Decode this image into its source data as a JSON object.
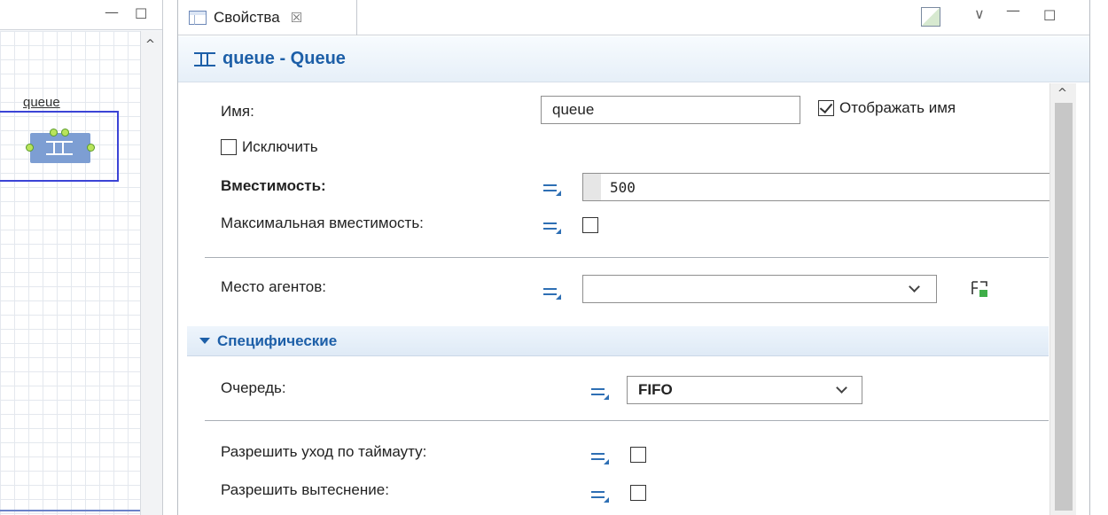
{
  "palette": {
    "accent": "#1d5fa8",
    "block": "#7d9ed3",
    "selection": "#3b44d6",
    "port": "#b9e45b"
  },
  "canvas": {
    "block_caption": "queue",
    "block_icon": "queue-block-icon",
    "scroll_up_glyph": "^"
  },
  "window_controls": {
    "minimize": "—",
    "maximize": "☐"
  },
  "tab": {
    "label": "Свойства",
    "close_glyph": "☒",
    "icon": "properties-icon"
  },
  "header": {
    "icon": "queue-icon",
    "title": "queue - Queue"
  },
  "properties": {
    "name": {
      "label": "Имя:",
      "value": "queue",
      "show_name_label": "Отображать имя",
      "show_name_checked": true
    },
    "exclude": {
      "label": "Исключить",
      "checked": false
    },
    "capacity": {
      "label": "Вместимость:",
      "value": "500"
    },
    "max_capacity": {
      "label": "Максимальная вместимость:",
      "checked": false
    },
    "agent_location": {
      "label": "Место агентов:",
      "value": ""
    }
  },
  "specific": {
    "section_label": "Специфические",
    "queue": {
      "label": "Очередь:",
      "value": "FIFO"
    },
    "timeout": {
      "label": "Разрешить уход по таймауту:",
      "checked": false
    },
    "preemption": {
      "label": "Разрешить вытеснение:",
      "checked": false
    }
  }
}
